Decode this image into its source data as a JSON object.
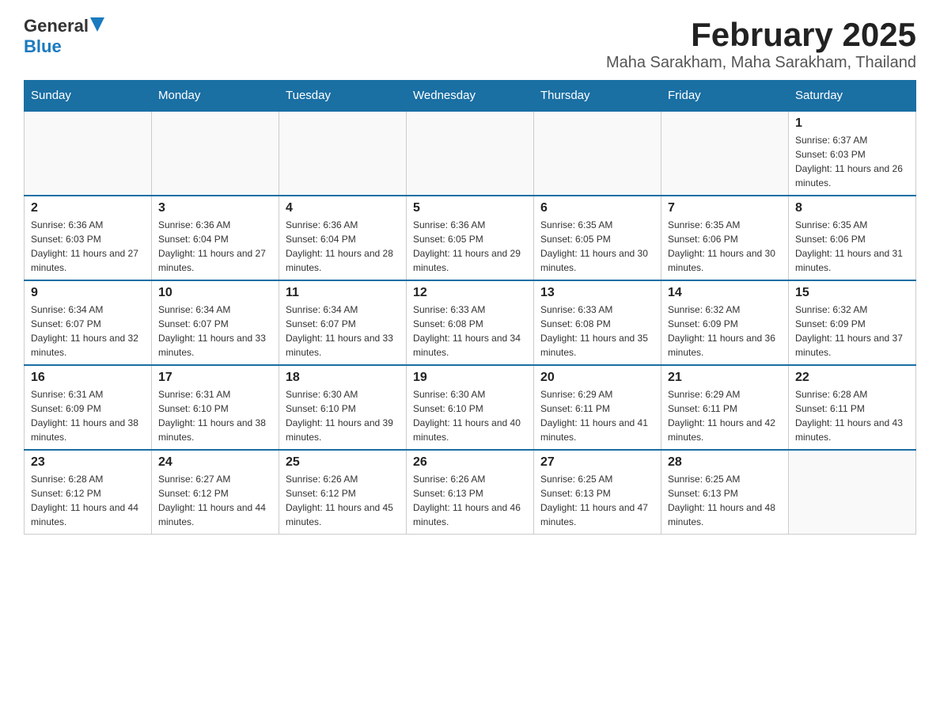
{
  "logo": {
    "general": "General",
    "blue": "Blue"
  },
  "title": "February 2025",
  "subtitle": "Maha Sarakham, Maha Sarakham, Thailand",
  "days_of_week": [
    "Sunday",
    "Monday",
    "Tuesday",
    "Wednesday",
    "Thursday",
    "Friday",
    "Saturday"
  ],
  "weeks": [
    [
      {
        "day": "",
        "info": ""
      },
      {
        "day": "",
        "info": ""
      },
      {
        "day": "",
        "info": ""
      },
      {
        "day": "",
        "info": ""
      },
      {
        "day": "",
        "info": ""
      },
      {
        "day": "",
        "info": ""
      },
      {
        "day": "1",
        "info": "Sunrise: 6:37 AM\nSunset: 6:03 PM\nDaylight: 11 hours and 26 minutes."
      }
    ],
    [
      {
        "day": "2",
        "info": "Sunrise: 6:36 AM\nSunset: 6:03 PM\nDaylight: 11 hours and 27 minutes."
      },
      {
        "day": "3",
        "info": "Sunrise: 6:36 AM\nSunset: 6:04 PM\nDaylight: 11 hours and 27 minutes."
      },
      {
        "day": "4",
        "info": "Sunrise: 6:36 AM\nSunset: 6:04 PM\nDaylight: 11 hours and 28 minutes."
      },
      {
        "day": "5",
        "info": "Sunrise: 6:36 AM\nSunset: 6:05 PM\nDaylight: 11 hours and 29 minutes."
      },
      {
        "day": "6",
        "info": "Sunrise: 6:35 AM\nSunset: 6:05 PM\nDaylight: 11 hours and 30 minutes."
      },
      {
        "day": "7",
        "info": "Sunrise: 6:35 AM\nSunset: 6:06 PM\nDaylight: 11 hours and 30 minutes."
      },
      {
        "day": "8",
        "info": "Sunrise: 6:35 AM\nSunset: 6:06 PM\nDaylight: 11 hours and 31 minutes."
      }
    ],
    [
      {
        "day": "9",
        "info": "Sunrise: 6:34 AM\nSunset: 6:07 PM\nDaylight: 11 hours and 32 minutes."
      },
      {
        "day": "10",
        "info": "Sunrise: 6:34 AM\nSunset: 6:07 PM\nDaylight: 11 hours and 33 minutes."
      },
      {
        "day": "11",
        "info": "Sunrise: 6:34 AM\nSunset: 6:07 PM\nDaylight: 11 hours and 33 minutes."
      },
      {
        "day": "12",
        "info": "Sunrise: 6:33 AM\nSunset: 6:08 PM\nDaylight: 11 hours and 34 minutes."
      },
      {
        "day": "13",
        "info": "Sunrise: 6:33 AM\nSunset: 6:08 PM\nDaylight: 11 hours and 35 minutes."
      },
      {
        "day": "14",
        "info": "Sunrise: 6:32 AM\nSunset: 6:09 PM\nDaylight: 11 hours and 36 minutes."
      },
      {
        "day": "15",
        "info": "Sunrise: 6:32 AM\nSunset: 6:09 PM\nDaylight: 11 hours and 37 minutes."
      }
    ],
    [
      {
        "day": "16",
        "info": "Sunrise: 6:31 AM\nSunset: 6:09 PM\nDaylight: 11 hours and 38 minutes."
      },
      {
        "day": "17",
        "info": "Sunrise: 6:31 AM\nSunset: 6:10 PM\nDaylight: 11 hours and 38 minutes."
      },
      {
        "day": "18",
        "info": "Sunrise: 6:30 AM\nSunset: 6:10 PM\nDaylight: 11 hours and 39 minutes."
      },
      {
        "day": "19",
        "info": "Sunrise: 6:30 AM\nSunset: 6:10 PM\nDaylight: 11 hours and 40 minutes."
      },
      {
        "day": "20",
        "info": "Sunrise: 6:29 AM\nSunset: 6:11 PM\nDaylight: 11 hours and 41 minutes."
      },
      {
        "day": "21",
        "info": "Sunrise: 6:29 AM\nSunset: 6:11 PM\nDaylight: 11 hours and 42 minutes."
      },
      {
        "day": "22",
        "info": "Sunrise: 6:28 AM\nSunset: 6:11 PM\nDaylight: 11 hours and 43 minutes."
      }
    ],
    [
      {
        "day": "23",
        "info": "Sunrise: 6:28 AM\nSunset: 6:12 PM\nDaylight: 11 hours and 44 minutes."
      },
      {
        "day": "24",
        "info": "Sunrise: 6:27 AM\nSunset: 6:12 PM\nDaylight: 11 hours and 44 minutes."
      },
      {
        "day": "25",
        "info": "Sunrise: 6:26 AM\nSunset: 6:12 PM\nDaylight: 11 hours and 45 minutes."
      },
      {
        "day": "26",
        "info": "Sunrise: 6:26 AM\nSunset: 6:13 PM\nDaylight: 11 hours and 46 minutes."
      },
      {
        "day": "27",
        "info": "Sunrise: 6:25 AM\nSunset: 6:13 PM\nDaylight: 11 hours and 47 minutes."
      },
      {
        "day": "28",
        "info": "Sunrise: 6:25 AM\nSunset: 6:13 PM\nDaylight: 11 hours and 48 minutes."
      },
      {
        "day": "",
        "info": ""
      }
    ]
  ]
}
